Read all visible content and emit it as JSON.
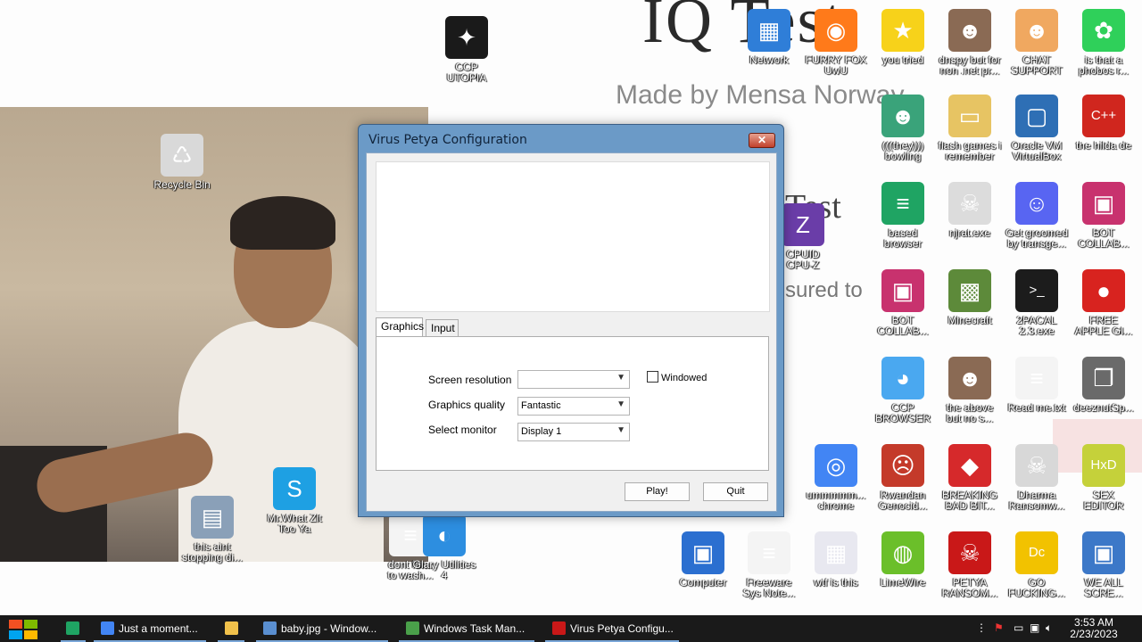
{
  "wallpaper": {
    "title_text": "IQ Test",
    "subtitle_text": "Made by Mensa Norway",
    "test_text": "Test",
    "sured_text": "sured to"
  },
  "desktop_icons": [
    {
      "label": "CCP\nUTOPIA",
      "icon": "ccp-utopia-icon",
      "color": "#1a1a1a"
    },
    {
      "label": "Recycle Bin",
      "icon": "recycle-bin-icon",
      "color": "#d9d9d9"
    },
    {
      "label": "Network",
      "icon": "network-icon",
      "color": "#2f7ed8"
    },
    {
      "label": "FURRY FOX\nUwU",
      "icon": "firefox-icon",
      "color": "#ff7a1a"
    },
    {
      "label": "you tried",
      "icon": "star-icon",
      "color": "#f7d21a"
    },
    {
      "label": "dnspy but for\nnon .net pr...",
      "icon": "portrait-icon",
      "color": "#8a6a54"
    },
    {
      "label": "CHAT\nSUPPORT",
      "icon": "chat-support-icon",
      "color": "#f0a860"
    },
    {
      "label": "is that a\nphobos r...",
      "icon": "lime-icon",
      "color": "#2fd05a"
    },
    {
      "label": "(((they)))\nbowling",
      "icon": "elf-icon",
      "color": "#3aa37a"
    },
    {
      "label": "flash games i\nremember",
      "icon": "folder-icon",
      "color": "#e7c463"
    },
    {
      "label": "Oracle VM\nVirtualBox",
      "icon": "virtualbox-icon",
      "color": "#2e6fb5"
    },
    {
      "label": "the hilda de",
      "icon": "devcpp-icon",
      "color": "#d0261e"
    },
    {
      "label": "CPUID\nCPU-Z",
      "icon": "cpuz-icon",
      "color": "#6a3da8"
    },
    {
      "label": "based\nbrowser",
      "icon": "sheets-icon",
      "color": "#1fa463"
    },
    {
      "label": "njrat.exe",
      "icon": "skull-icon",
      "color": "#dcdcdc"
    },
    {
      "label": "Get groomed\nby transge...",
      "icon": "discord-icon",
      "color": "#5865f2"
    },
    {
      "label": "BOT\nCOLLAB...",
      "icon": "monitor-icon",
      "color": "#c8326e"
    },
    {
      "label": "BOT\nCOLLAB...",
      "icon": "monitor-icon",
      "color": "#c8326e"
    },
    {
      "label": "Minecraft",
      "icon": "minecraft-icon",
      "color": "#5d8a3a"
    },
    {
      "label": "2PACAL\n2.3.exe",
      "icon": "cmd-icon",
      "color": "#1c1c1c"
    },
    {
      "label": "FREE\nAPPLE GI...",
      "icon": "apple-icon",
      "color": "#d8231f"
    },
    {
      "label": "CCP\nBROWSER",
      "icon": "ccp-browser-icon",
      "color": "#4aa8f0"
    },
    {
      "label": "the above\nbut no s...",
      "icon": "portrait-icon",
      "color": "#8a6a54"
    },
    {
      "label": "Read me.txt",
      "icon": "text-file-icon",
      "color": "#f4f4f4"
    },
    {
      "label": "deeznutSp...",
      "icon": "windows-stack-icon",
      "color": "#6a6a6a"
    },
    {
      "label": "ummmmm...\nchrome",
      "icon": "chrome-icon",
      "color": "#4285f4"
    },
    {
      "label": "Rwandan\nGenocid...",
      "icon": "trollface-icon",
      "color": "#c43a2a"
    },
    {
      "label": "BREAKING\nBAD BIT...",
      "icon": "angry-bird-icon",
      "color": "#d6292b"
    },
    {
      "label": "Dharma\nRansomw...",
      "icon": "skull-mask-icon",
      "color": "#d8d8d8"
    },
    {
      "label": "SEX\nEDITOR",
      "icon": "hxd-icon",
      "color": "#c5d13a"
    },
    {
      "label": "Mr.What Zit\nToo Ya",
      "icon": "skype-icon",
      "color": "#1ea0e3"
    },
    {
      "label": "this aint\nstopping di...",
      "icon": "scanner-icon",
      "color": "#8aa0b8"
    },
    {
      "label": "dont for...\nto wash...",
      "icon": "text-file-icon",
      "color": "#f4f4f4"
    },
    {
      "label": "Glary Utilities\n4",
      "icon": "glary-icon",
      "color": "#2d8ee0"
    },
    {
      "label": "Computer",
      "icon": "computer-icon",
      "color": "#2b6fd0"
    },
    {
      "label": "Freeware\nSys Note...",
      "icon": "document-icon",
      "color": "#f4f4f4"
    },
    {
      "label": "wtf is this",
      "icon": "calendar-icon",
      "color": "#e8e8f0"
    },
    {
      "label": "LimeWire",
      "icon": "limewire-icon",
      "color": "#6bbf2a"
    },
    {
      "label": "PETYA\nRANSOM...",
      "icon": "petya-icon",
      "color": "#c91818"
    },
    {
      "label": "GO\nFUCKING...",
      "icon": "dc-icon",
      "color": "#f2c200"
    },
    {
      "label": "WE ALL\nSCRE...",
      "icon": "pc-icon",
      "color": "#3c78c8"
    }
  ],
  "dialog": {
    "title": "Virus Petya Configuration",
    "close_label": "✕",
    "tabs": [
      {
        "label": "Graphics",
        "active": true
      },
      {
        "label": "Input",
        "active": false
      }
    ],
    "fields": {
      "screen_resolution_label": "Screen resolution",
      "screen_resolution_value": "",
      "graphics_quality_label": "Graphics quality",
      "graphics_quality_value": "Fantastic",
      "select_monitor_label": "Select monitor",
      "select_monitor_value": "Display 1",
      "windowed_label": "Windowed",
      "windowed_checked": false
    },
    "play_label": "Play!",
    "quit_label": "Quit"
  },
  "taskbar": {
    "items": [
      {
        "label": "Just a moment...",
        "icon": "chrome-icon",
        "color": "#4285f4"
      },
      {
        "label": "",
        "icon": "file-explorer-icon",
        "color": "#f1c14b"
      },
      {
        "label": "baby.jpg - Window...",
        "icon": "photo-viewer-icon",
        "color": "#5a8fd0"
      },
      {
        "label": "Windows Task Man...",
        "icon": "task-manager-icon",
        "color": "#4aa04a"
      },
      {
        "label": "Virus Petya Configu...",
        "icon": "petya-icon",
        "color": "#c91818"
      }
    ],
    "time": "3:53 AM",
    "date": "2/23/2023",
    "accent": "#7aa7d8"
  }
}
